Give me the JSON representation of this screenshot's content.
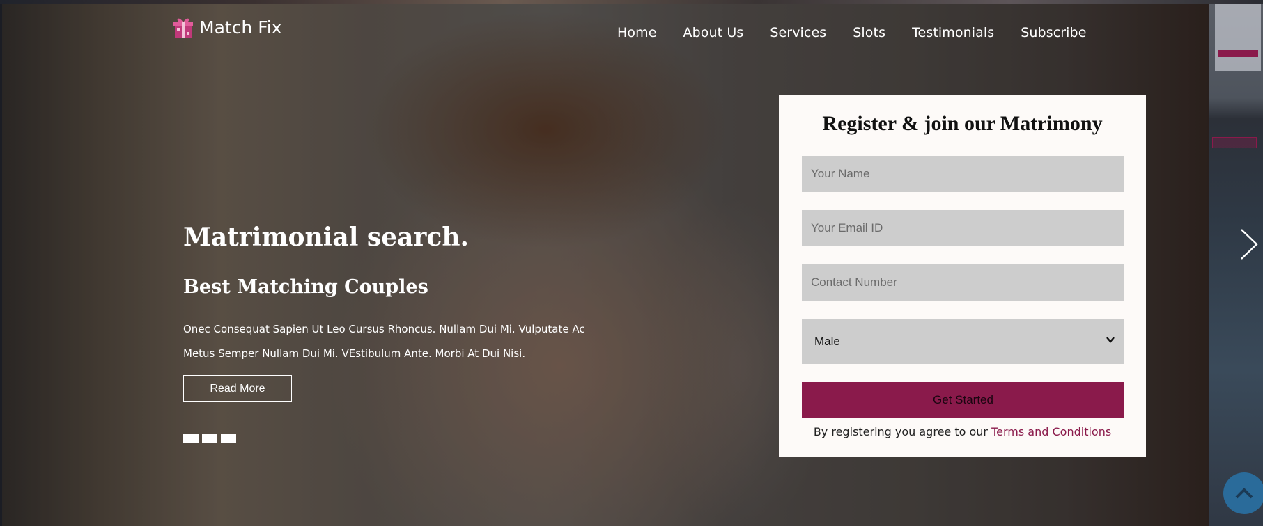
{
  "brand": {
    "name": "Match Fix",
    "accent": "#8a1a4b"
  },
  "nav": {
    "items": [
      {
        "label": "Home"
      },
      {
        "label": "About Us"
      },
      {
        "label": "Services"
      },
      {
        "label": "Slots"
      },
      {
        "label": "Testimonials"
      },
      {
        "label": "Subscribe"
      }
    ]
  },
  "hero": {
    "title": "Matrimonial search.",
    "subtitle": "Best Matching Couples",
    "description_line1": "Onec Consequat Sapien Ut Leo Cursus Rhoncus. Nullam Dui Mi. Vulputate Ac",
    "description_line2": "Metus Semper Nullam Dui Mi. VEstibulum Ante. Morbi At Dui Nisi.",
    "read_more_label": "Read More",
    "slide_count": 3
  },
  "register": {
    "title": "Register & join our Matrimony",
    "name_placeholder": "Your Name",
    "email_placeholder": "Your Email ID",
    "contact_placeholder": "Contact Number",
    "gender_selected": "Male",
    "submit_label": "Get Started",
    "terms_prefix": "By registering you agree to our",
    "terms_link": "Terms and Conditions"
  },
  "icons": {
    "logo": "gift-icon",
    "next": "chevron-right-icon",
    "back_to_top": "chevron-up-icon",
    "select": "chevron-down-icon"
  }
}
